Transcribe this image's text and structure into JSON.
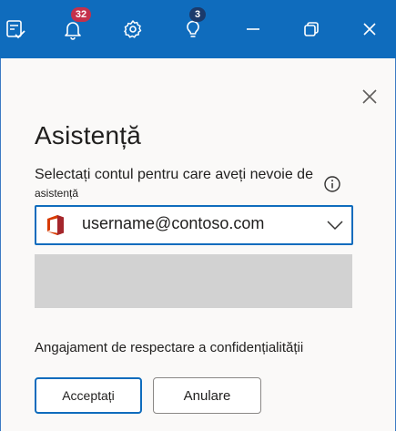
{
  "titlebar": {
    "notifications_count": "32",
    "ideas_count": "3"
  },
  "panel": {
    "title": "Asistență",
    "account_label_line1": "Selectați contul pentru care aveți nevoie de",
    "account_label_line2": "asistență",
    "account_value": "username@contoso.com",
    "privacy_text": "Angajament de respectare a confidențialității",
    "accept_label": "Acceptați",
    "cancel_label": "Anulare"
  },
  "colors": {
    "titlebar": "#0f6cbd",
    "badge_red": "#c4314b",
    "accent": "#0f6cbd"
  },
  "icons": {
    "titlebar": [
      "task-check-icon",
      "bell-icon",
      "gear-icon",
      "lightbulb-icon",
      "minimize-icon",
      "restore-icon",
      "close-icon"
    ],
    "panel": [
      "close-icon",
      "info-icon",
      "office-logo-icon",
      "chevron-down-icon"
    ]
  }
}
